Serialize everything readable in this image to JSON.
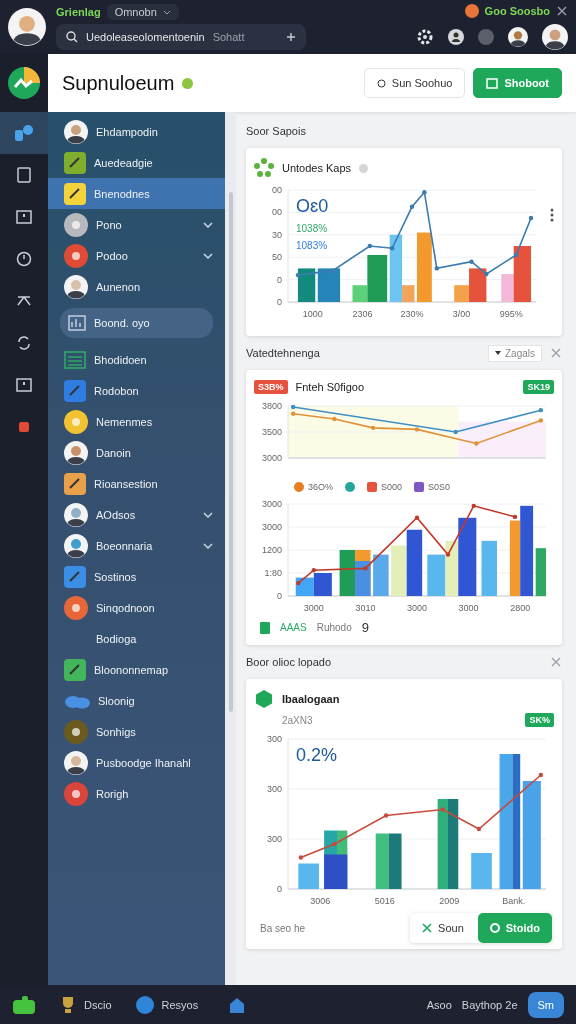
{
  "top_bar": {
    "app_name": "Grienlag",
    "workspace": "Omnobn",
    "search": {
      "value": "Uedoleaseolomentoenin",
      "scope": "Sohatt"
    },
    "status": "Goo Soosbo"
  },
  "header": {
    "title": "Supnuloeum",
    "buttons": [
      {
        "label": "Sun Soohuo",
        "kind": "outline"
      },
      {
        "label": "Shoboot",
        "kind": "primary"
      }
    ]
  },
  "rail": [
    {
      "kind": "blocks",
      "selected": true
    },
    {
      "kind": "tablet",
      "selected": false
    },
    {
      "kind": "frame",
      "selected": false
    },
    {
      "kind": "clock",
      "selected": false
    },
    {
      "kind": "shuffle",
      "selected": false
    },
    {
      "kind": "sync",
      "selected": false
    },
    {
      "kind": "frame",
      "selected": false
    },
    {
      "kind": "alert",
      "selected": false
    }
  ],
  "sidebar": {
    "items": [
      {
        "label": "Ehdampodin",
        "kind": "row",
        "selected": false,
        "chevron": false
      },
      {
        "label": "Auedeadgie",
        "kind": "row",
        "selected": false,
        "chevron": false
      },
      {
        "label": "Bnenodnes",
        "kind": "row",
        "selected": true,
        "chevron": false
      },
      {
        "label": "Pono",
        "kind": "row",
        "selected": false,
        "chevron": true
      },
      {
        "label": "Podoo",
        "kind": "row",
        "selected": false,
        "chevron": true
      },
      {
        "label": "Aunenon",
        "kind": "row",
        "selected": false,
        "chevron": false
      },
      {
        "label": "Boond. oyo",
        "kind": "pill",
        "selected": false,
        "chevron": false
      },
      {
        "label": "Bhodidoen",
        "kind": "row",
        "selected": false,
        "chevron": false
      },
      {
        "label": "Rodobon",
        "kind": "row",
        "selected": false,
        "chevron": false
      },
      {
        "label": "Nemenmes",
        "kind": "row",
        "selected": false,
        "chevron": false
      },
      {
        "label": "Danoin",
        "kind": "row",
        "selected": false,
        "chevron": false
      },
      {
        "label": "Rioansestion",
        "kind": "row",
        "selected": false,
        "chevron": false
      },
      {
        "label": "AOdsos",
        "kind": "row",
        "selected": false,
        "chevron": true
      },
      {
        "label": "Boeonnaria",
        "kind": "row",
        "selected": false,
        "chevron": true
      },
      {
        "label": "Sostinos",
        "kind": "row",
        "selected": false,
        "chevron": false
      },
      {
        "label": "Sinqodnoon",
        "kind": "row",
        "selected": false,
        "chevron": false
      },
      {
        "label": "Bodioga",
        "kind": "row",
        "selected": false,
        "chevron": false
      },
      {
        "label": "Bloononnemap",
        "kind": "row",
        "selected": false,
        "chevron": false
      },
      {
        "label": "Sloonig",
        "kind": "row",
        "selected": false,
        "chevron": false
      },
      {
        "label": "Sonhigs",
        "kind": "row",
        "selected": false,
        "chevron": false
      },
      {
        "label": "Pusboodge Ihanahl",
        "kind": "row",
        "selected": false,
        "chevron": false
      },
      {
        "label": "Rorigh",
        "kind": "row",
        "selected": false,
        "chevron": false
      }
    ]
  },
  "sections": [
    {
      "title": "Soor Sapois",
      "closable": false,
      "card": {
        "kind": "combo",
        "title": "Untodes Kaps",
        "headline": "Oɛ0",
        "stats": [
          "1038%",
          "1083%"
        ],
        "y_labels": [
          "00",
          "00",
          "30",
          "50",
          "0",
          "0"
        ],
        "x_labels": [
          "1000",
          "2306",
          "230%",
          "3/00",
          "995%"
        ]
      }
    },
    {
      "title": "Vatedtehnenga",
      "filter": "Zagals",
      "closable": true,
      "card": {
        "kind": "trend",
        "badge": "S3B%",
        "title": "Fnteh S0figoo",
        "tag": "SK19",
        "top_labels": [
          "3800",
          "3500",
          "3000"
        ],
        "legend": [
          {
            "kind": "dot",
            "color": "#e67e22",
            "label": "36O%"
          },
          {
            "kind": "dot",
            "color": "#26a69a"
          },
          {
            "kind": "square",
            "color": "#e5533d",
            "label": "S000"
          },
          {
            "kind": "square",
            "color": "#7e57c2",
            "label": "S0S0"
          }
        ],
        "y_labels": [
          "3000",
          "3000",
          "1200",
          "1:80",
          "0"
        ],
        "x_labels": [
          "3000",
          "3010",
          "3000",
          "3000",
          "2800"
        ],
        "footer": {
          "value": "AAAS",
          "label": "Ruhodo",
          "count": "9"
        }
      }
    },
    {
      "title": "Boor olioc lopado",
      "closable": true,
      "card": {
        "kind": "bars",
        "title": "Ibaalogaan",
        "subtitle": "2aXN3",
        "tag": "SK%",
        "headline": "0.2%",
        "y_labels": [
          "300",
          "300",
          "300",
          "0"
        ],
        "x_labels": [
          "3006",
          "5016",
          "2009",
          "Bank."
        ],
        "footnote": "Ba seo he",
        "actions": [
          {
            "label": "Soun",
            "kind": "outline"
          },
          {
            "label": "Stoido",
            "kind": "primary"
          }
        ]
      }
    }
  ],
  "bottom_bar": {
    "items": [
      {
        "label": "Dscio",
        "kind": "trophy"
      },
      {
        "label": "Resyos",
        "kind": "dot"
      }
    ],
    "links": [
      "Asoo",
      "Baythop 2e"
    ],
    "button": "Sm"
  }
}
